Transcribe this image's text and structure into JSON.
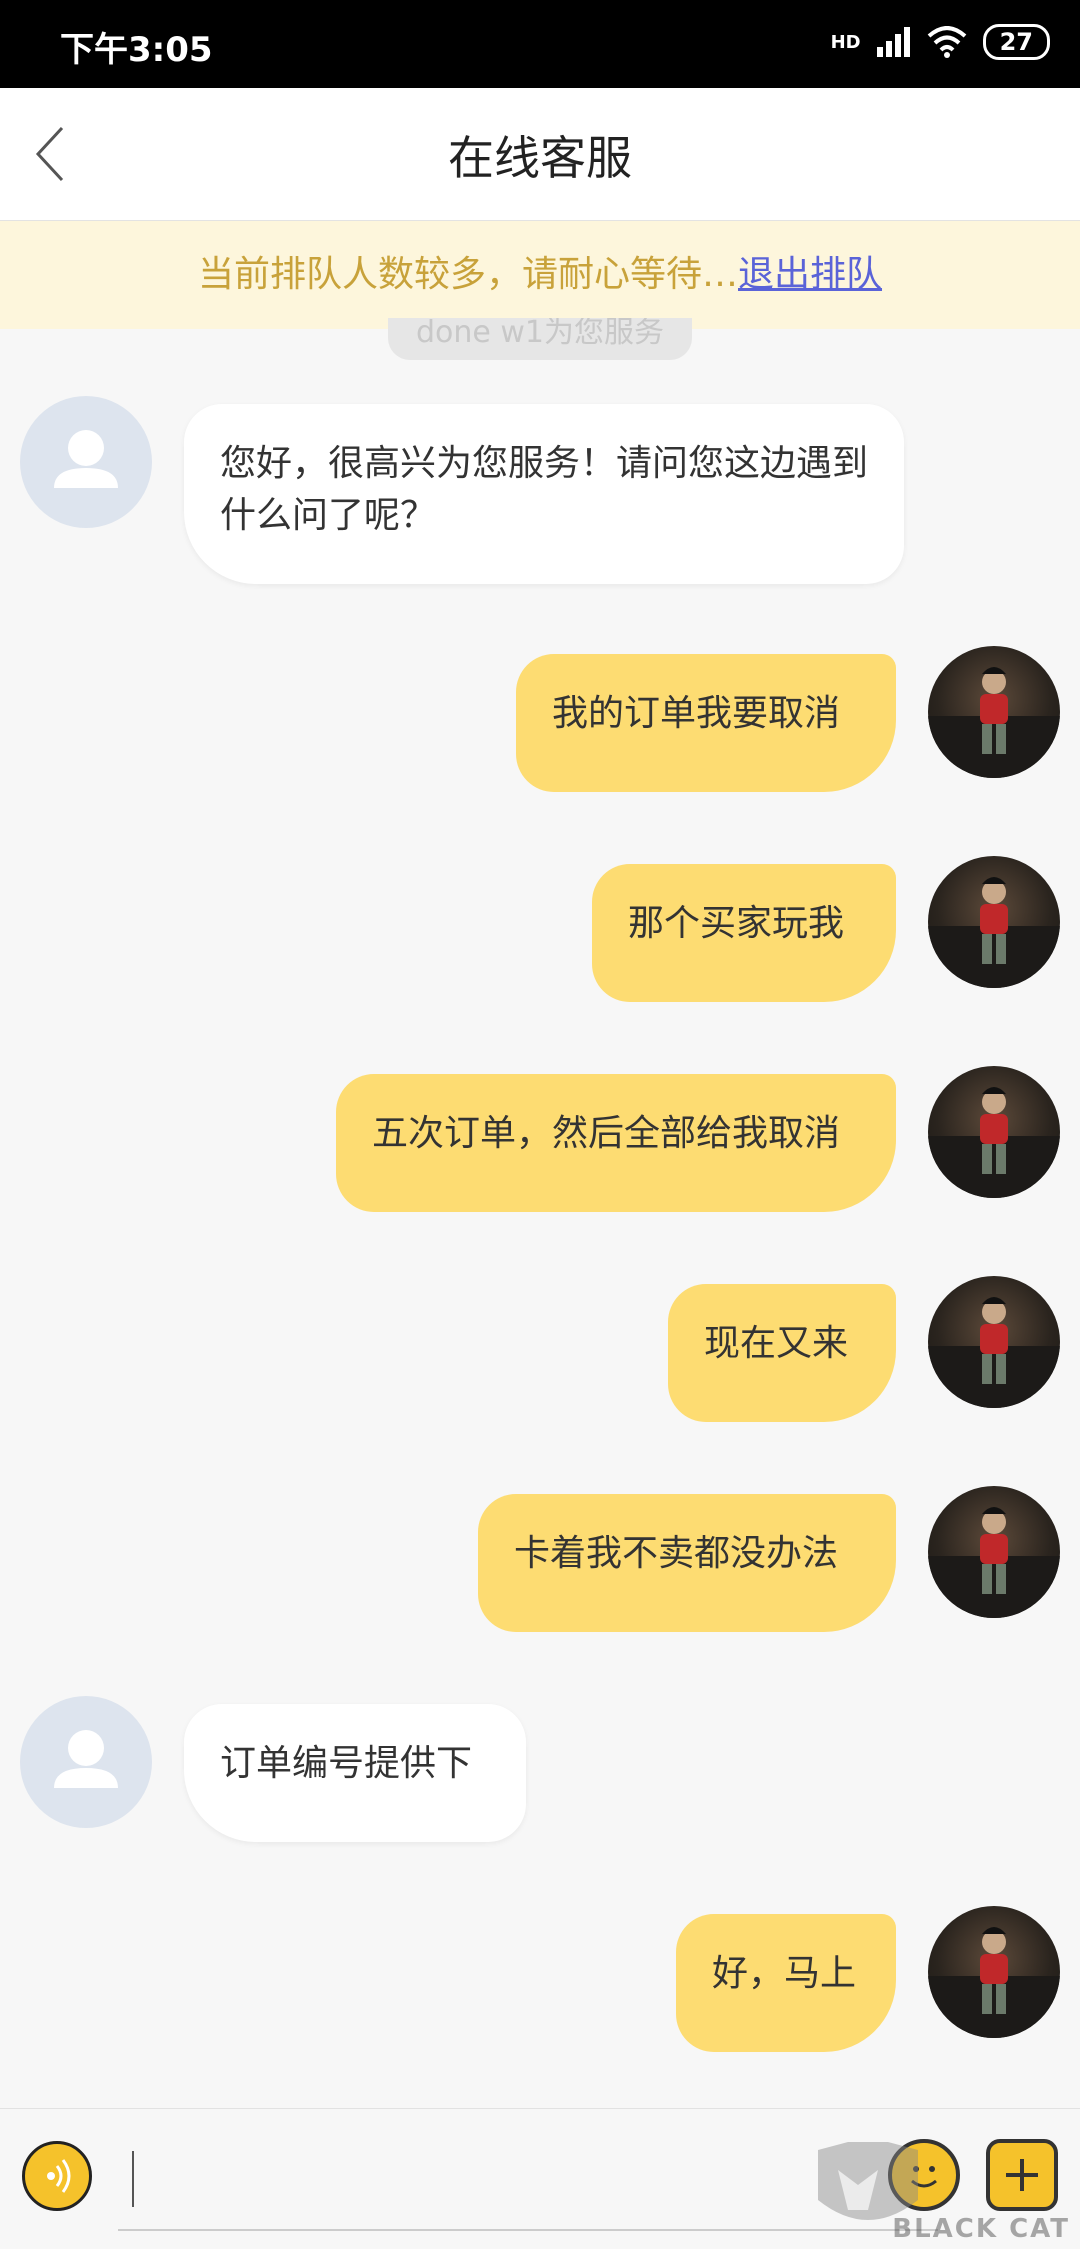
{
  "status_bar": {
    "time": "下午3:05",
    "network": "HD",
    "battery": "27"
  },
  "header": {
    "title": "在线客服"
  },
  "banner": {
    "text": "当前排队人数较多，请耐心等待…",
    "quit_label": "退出排队"
  },
  "system_notice": "done w1为您服务",
  "messages": [
    {
      "from": "agent",
      "text": "您好，很高兴为您服务！请问您这边遇到什么问了呢？"
    },
    {
      "from": "user",
      "text": "我的订单我要取消"
    },
    {
      "from": "user",
      "text": "那个买家玩我"
    },
    {
      "from": "user",
      "text": "五次订单，然后全部给我取消"
    },
    {
      "from": "user",
      "text": "现在又来"
    },
    {
      "from": "user",
      "text": "卡着我不卖都没办法"
    },
    {
      "from": "agent",
      "text": "订单编号提供下"
    },
    {
      "from": "user",
      "text": "好，马上"
    }
  ],
  "input": {
    "value": ""
  },
  "watermark": {
    "text": "BLACK CAT"
  },
  "colors": {
    "user_bubble": "#fddc72",
    "agent_bubble": "#ffffff",
    "banner_bg": "#fdf6dc",
    "link": "#5a63d8"
  }
}
